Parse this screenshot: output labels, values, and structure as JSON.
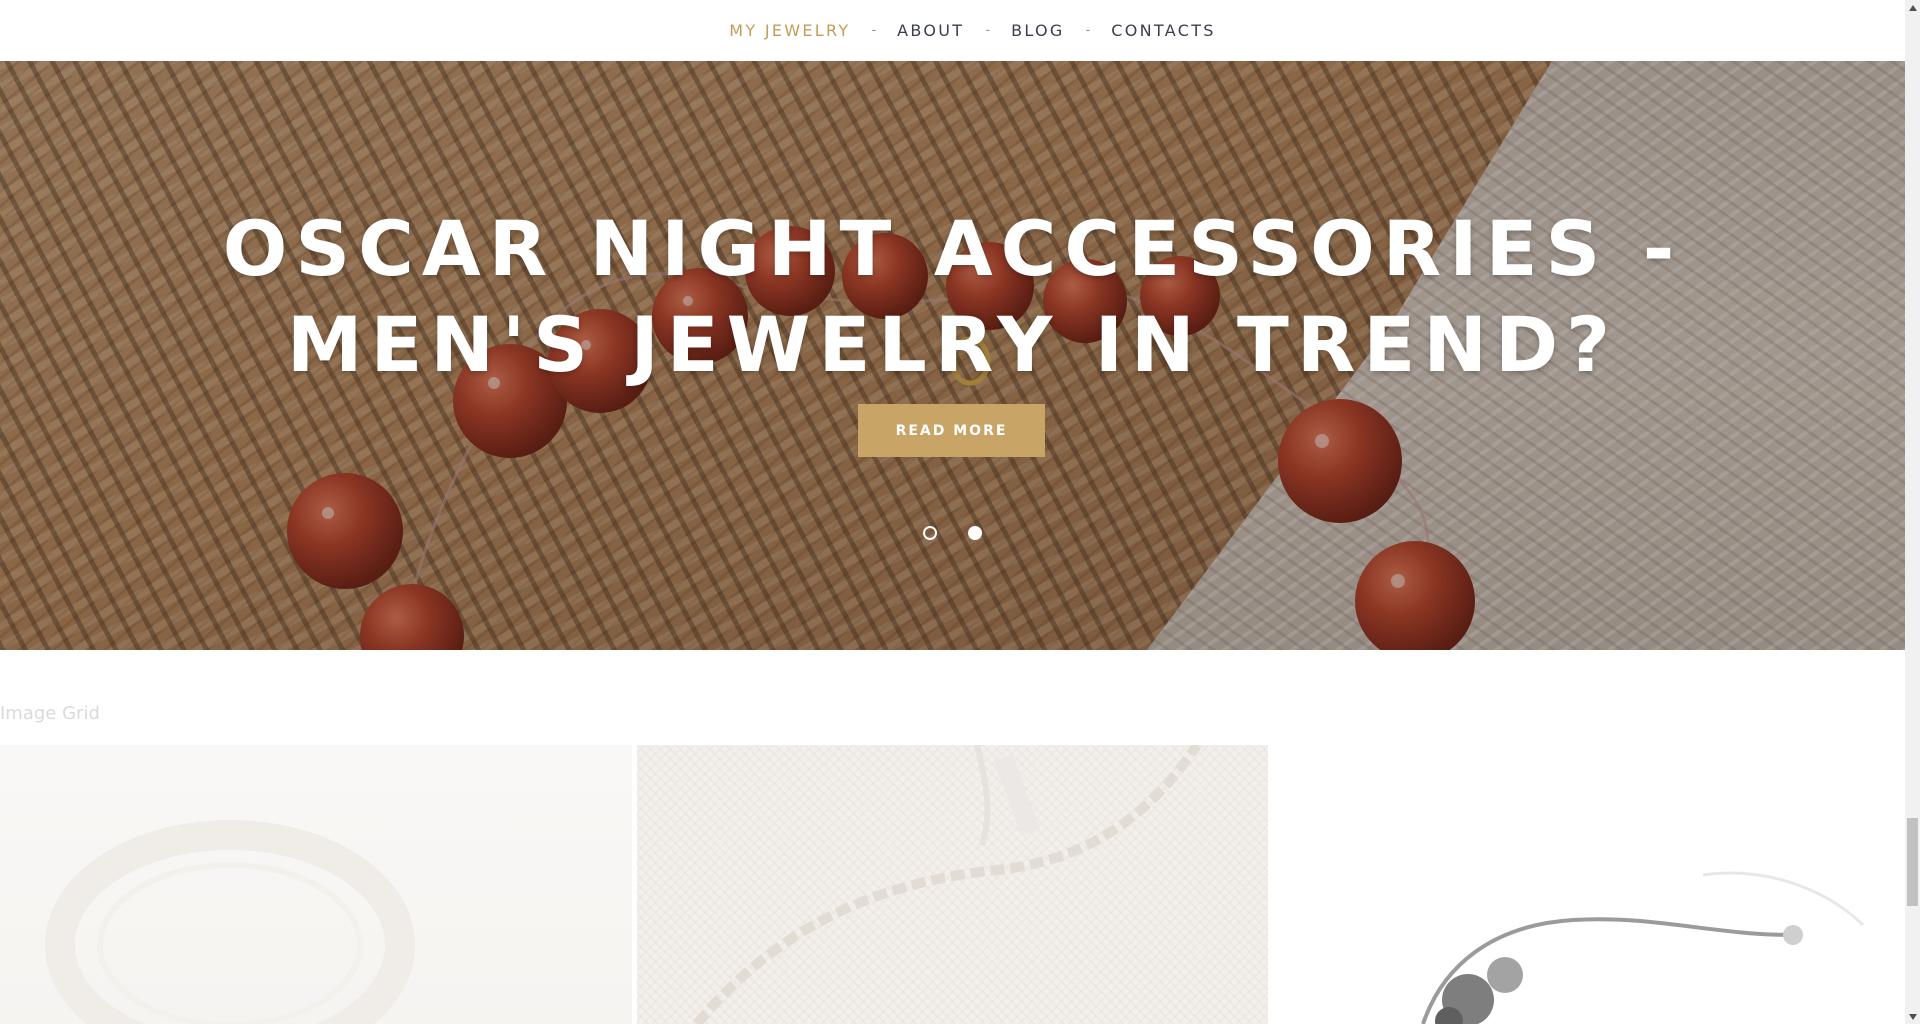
{
  "nav": {
    "items": [
      {
        "label": "MY JEWELRY",
        "active": true
      },
      {
        "label": "ABOUT",
        "active": false
      },
      {
        "label": "BLOG",
        "active": false
      },
      {
        "label": "CONTACTS",
        "active": false
      }
    ],
    "separator": "-",
    "active_color": "#c39d58",
    "text_color": "#3a3f4b"
  },
  "hero": {
    "title": "OSCAR NIGHT ACCESSORIES - MEN'S JEWELRY IN TREND?",
    "button_label": "READ MORE",
    "button_color": "#c8a466",
    "slides": 2,
    "active_slide": 2
  },
  "grid": {
    "heading": "Image Grid"
  }
}
